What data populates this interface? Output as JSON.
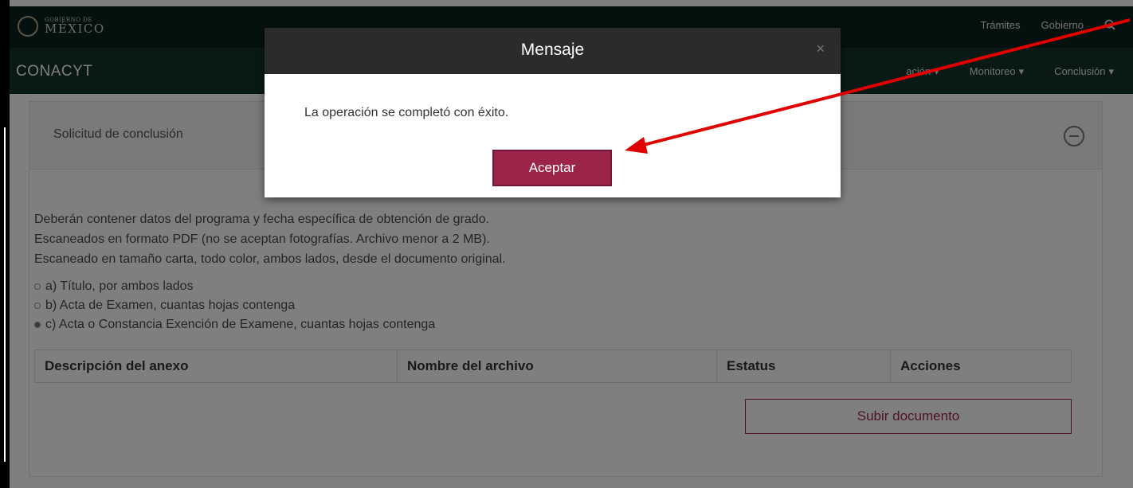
{
  "header": {
    "gov_small": "GOBIERNO DE",
    "gov_big": "MÉXICO",
    "links": [
      "Trámites",
      "Gobierno"
    ],
    "search_icon": "search-icon"
  },
  "nav": {
    "brand": "CONACYT",
    "items": [
      "ación",
      "Monitoreo",
      "Conclusión"
    ]
  },
  "panel": {
    "title": "Solicitud de conclusión",
    "requirements": [
      "Deberán contener datos del programa y fecha específica de obtención de grado.",
      "Escaneados en formato PDF (no se aceptan fotografías. Archivo menor a 2 MB).",
      "Escaneado en tamaño carta, todo color, ambos lados, desde el documento original."
    ],
    "options": [
      {
        "label": "a) Título, por ambos lados",
        "selected": false
      },
      {
        "label": "b) Acta de Examen, cuantas hojas contenga",
        "selected": false
      },
      {
        "label": "c) Acta o Constancia Exención de Examene, cuantas hojas contenga",
        "selected": true
      }
    ],
    "table_headers": [
      "Descripción del anexo",
      "Nombre del archivo",
      "Estatus",
      "Acciones"
    ],
    "upload_label": "Subir documento"
  },
  "modal": {
    "title": "Mensaje",
    "close": "×",
    "message": "La operación se completó con éxito.",
    "accept_label": "Aceptar"
  },
  "colors": {
    "accent": "#9d2449",
    "header_dark": "#0b231e",
    "nav_dark": "#13322b",
    "annotation": "#e00000"
  }
}
